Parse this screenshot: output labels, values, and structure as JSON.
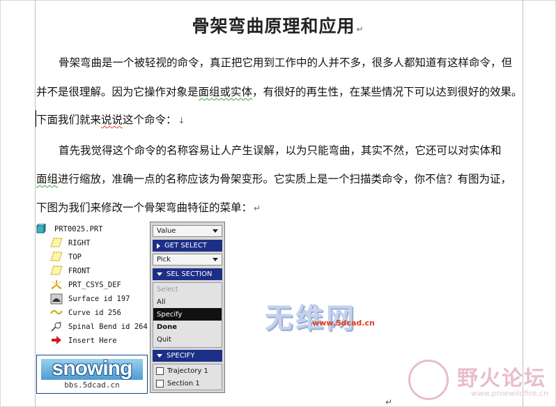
{
  "article": {
    "title": "骨架弯曲原理和应用",
    "paragraph_mark": "↵",
    "p1_line1": "骨架弯曲是一个被轻视的命令，真正把它用到工作中的人并不多，很多人都知道有这样命令，但",
    "p1_line2_a": "并不是很理解。因为它操作对象是",
    "p1_line2_b": "面组或实体",
    "p1_line2_c": "，有很好的再生性，在某些情况下可以达到很好的效果。",
    "p1_line3_a": "下面我们就来",
    "p1_line3_b": "说说",
    "p1_line3_c": "这个命令：",
    "p1_line3_mark": "↓",
    "p2_line1": "首先我觉得这个命令的名称容易让人产生误解，以为只能弯曲，其实不然，它还可以对实体和",
    "p2_line2_a": "面组",
    "p2_line2_b": "进行缩放，准确一点的名称应该为骨架变形。它实质上是一个扫描类命令，你不信？有图为证，",
    "p2_line3": "下图为我们来修改一个骨架弯曲特征的菜单："
  },
  "model_tree": {
    "items": [
      {
        "label": "PRT0025.PRT",
        "icon": "part-icon"
      },
      {
        "label": "RIGHT",
        "icon": "datum-plane-icon"
      },
      {
        "label": "TOP",
        "icon": "datum-plane-icon"
      },
      {
        "label": "FRONT",
        "icon": "datum-plane-icon"
      },
      {
        "label": "PRT_CSYS_DEF",
        "icon": "csys-icon"
      },
      {
        "label": "Surface id 197",
        "icon": "surface-icon"
      },
      {
        "label": "Curve id 256",
        "icon": "curve-icon"
      },
      {
        "label": "Spinal Bend id 264",
        "icon": "spinal-bend-icon"
      },
      {
        "label": "Insert Here",
        "icon": "insert-arrow-icon"
      }
    ]
  },
  "logo": {
    "title": "snowing",
    "subtitle": "bbs.5dcad.cn"
  },
  "menu": {
    "value_dropdown": "Value",
    "get_select_header": "GET SELECT",
    "pick_dropdown": "Pick",
    "sel_section_header": "SEL SECTION",
    "sel_section_items": [
      "Select",
      "All",
      "Specify",
      "Done",
      "Quit"
    ],
    "specify_header": "SPECIFY",
    "specify_items": [
      "Trajectory 1",
      "Section 1"
    ]
  },
  "watermarks": {
    "wm1_title": "无维网",
    "wm1_url": "www.5dcad.cn",
    "wm2_title": "野火论坛",
    "wm2_url": "www.proewildfire.cn"
  },
  "colors": {
    "menu_header": "#1c2f87",
    "menu_selected": "#111111",
    "grammar_squiggle": "#3aa13a",
    "spell_squiggle": "#e33333"
  }
}
